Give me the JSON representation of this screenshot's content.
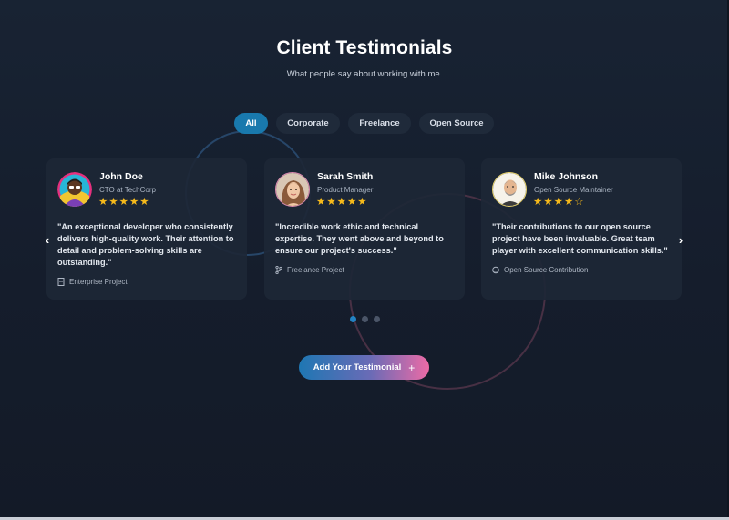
{
  "header": {
    "title": "Client Testimonials",
    "subtitle": "What people say about working with me."
  },
  "filters": [
    {
      "label": "All",
      "active": true
    },
    {
      "label": "Corporate",
      "active": false
    },
    {
      "label": "Freelance",
      "active": false
    },
    {
      "label": "Open Source",
      "active": false
    }
  ],
  "testimonials": [
    {
      "name": "John Doe",
      "role": "CTO at TechCorp",
      "rating": 5,
      "quote": "\"An exceptional developer who consistently delivers high-quality work. Their attention to detail and problem-solving skills are outstanding.\"",
      "tag": "Enterprise Project",
      "tag_icon": "building-icon"
    },
    {
      "name": "Sarah Smith",
      "role": "Product Manager",
      "rating": 5,
      "quote": "\"Incredible work ethic and technical expertise. They went above and beyond to ensure our project's success.\"",
      "tag": "Freelance Project",
      "tag_icon": "code-branch-icon"
    },
    {
      "name": "Mike Johnson",
      "role": "Open Source Maintainer",
      "rating": 4,
      "quote": "\"Their contributions to our open source project have been invaluable. Great team player with excellent communication skills.\"",
      "tag": "Open Source Contribution",
      "tag_icon": "github-icon"
    }
  ],
  "carousel": {
    "prev_icon": "chevron-left-icon",
    "next_icon": "chevron-right-icon",
    "prev_glyph": "‹",
    "next_glyph": "›",
    "page_count": 3,
    "active_page": 1
  },
  "cta": {
    "label": "Add Your Testimonial",
    "icon": "plus-icon",
    "icon_glyph": "+"
  },
  "colors": {
    "accent": "#1979ad",
    "star": "#f5b91b",
    "cta_gradient_start": "#1e77b3",
    "cta_gradient_end": "#ec6ba6"
  }
}
